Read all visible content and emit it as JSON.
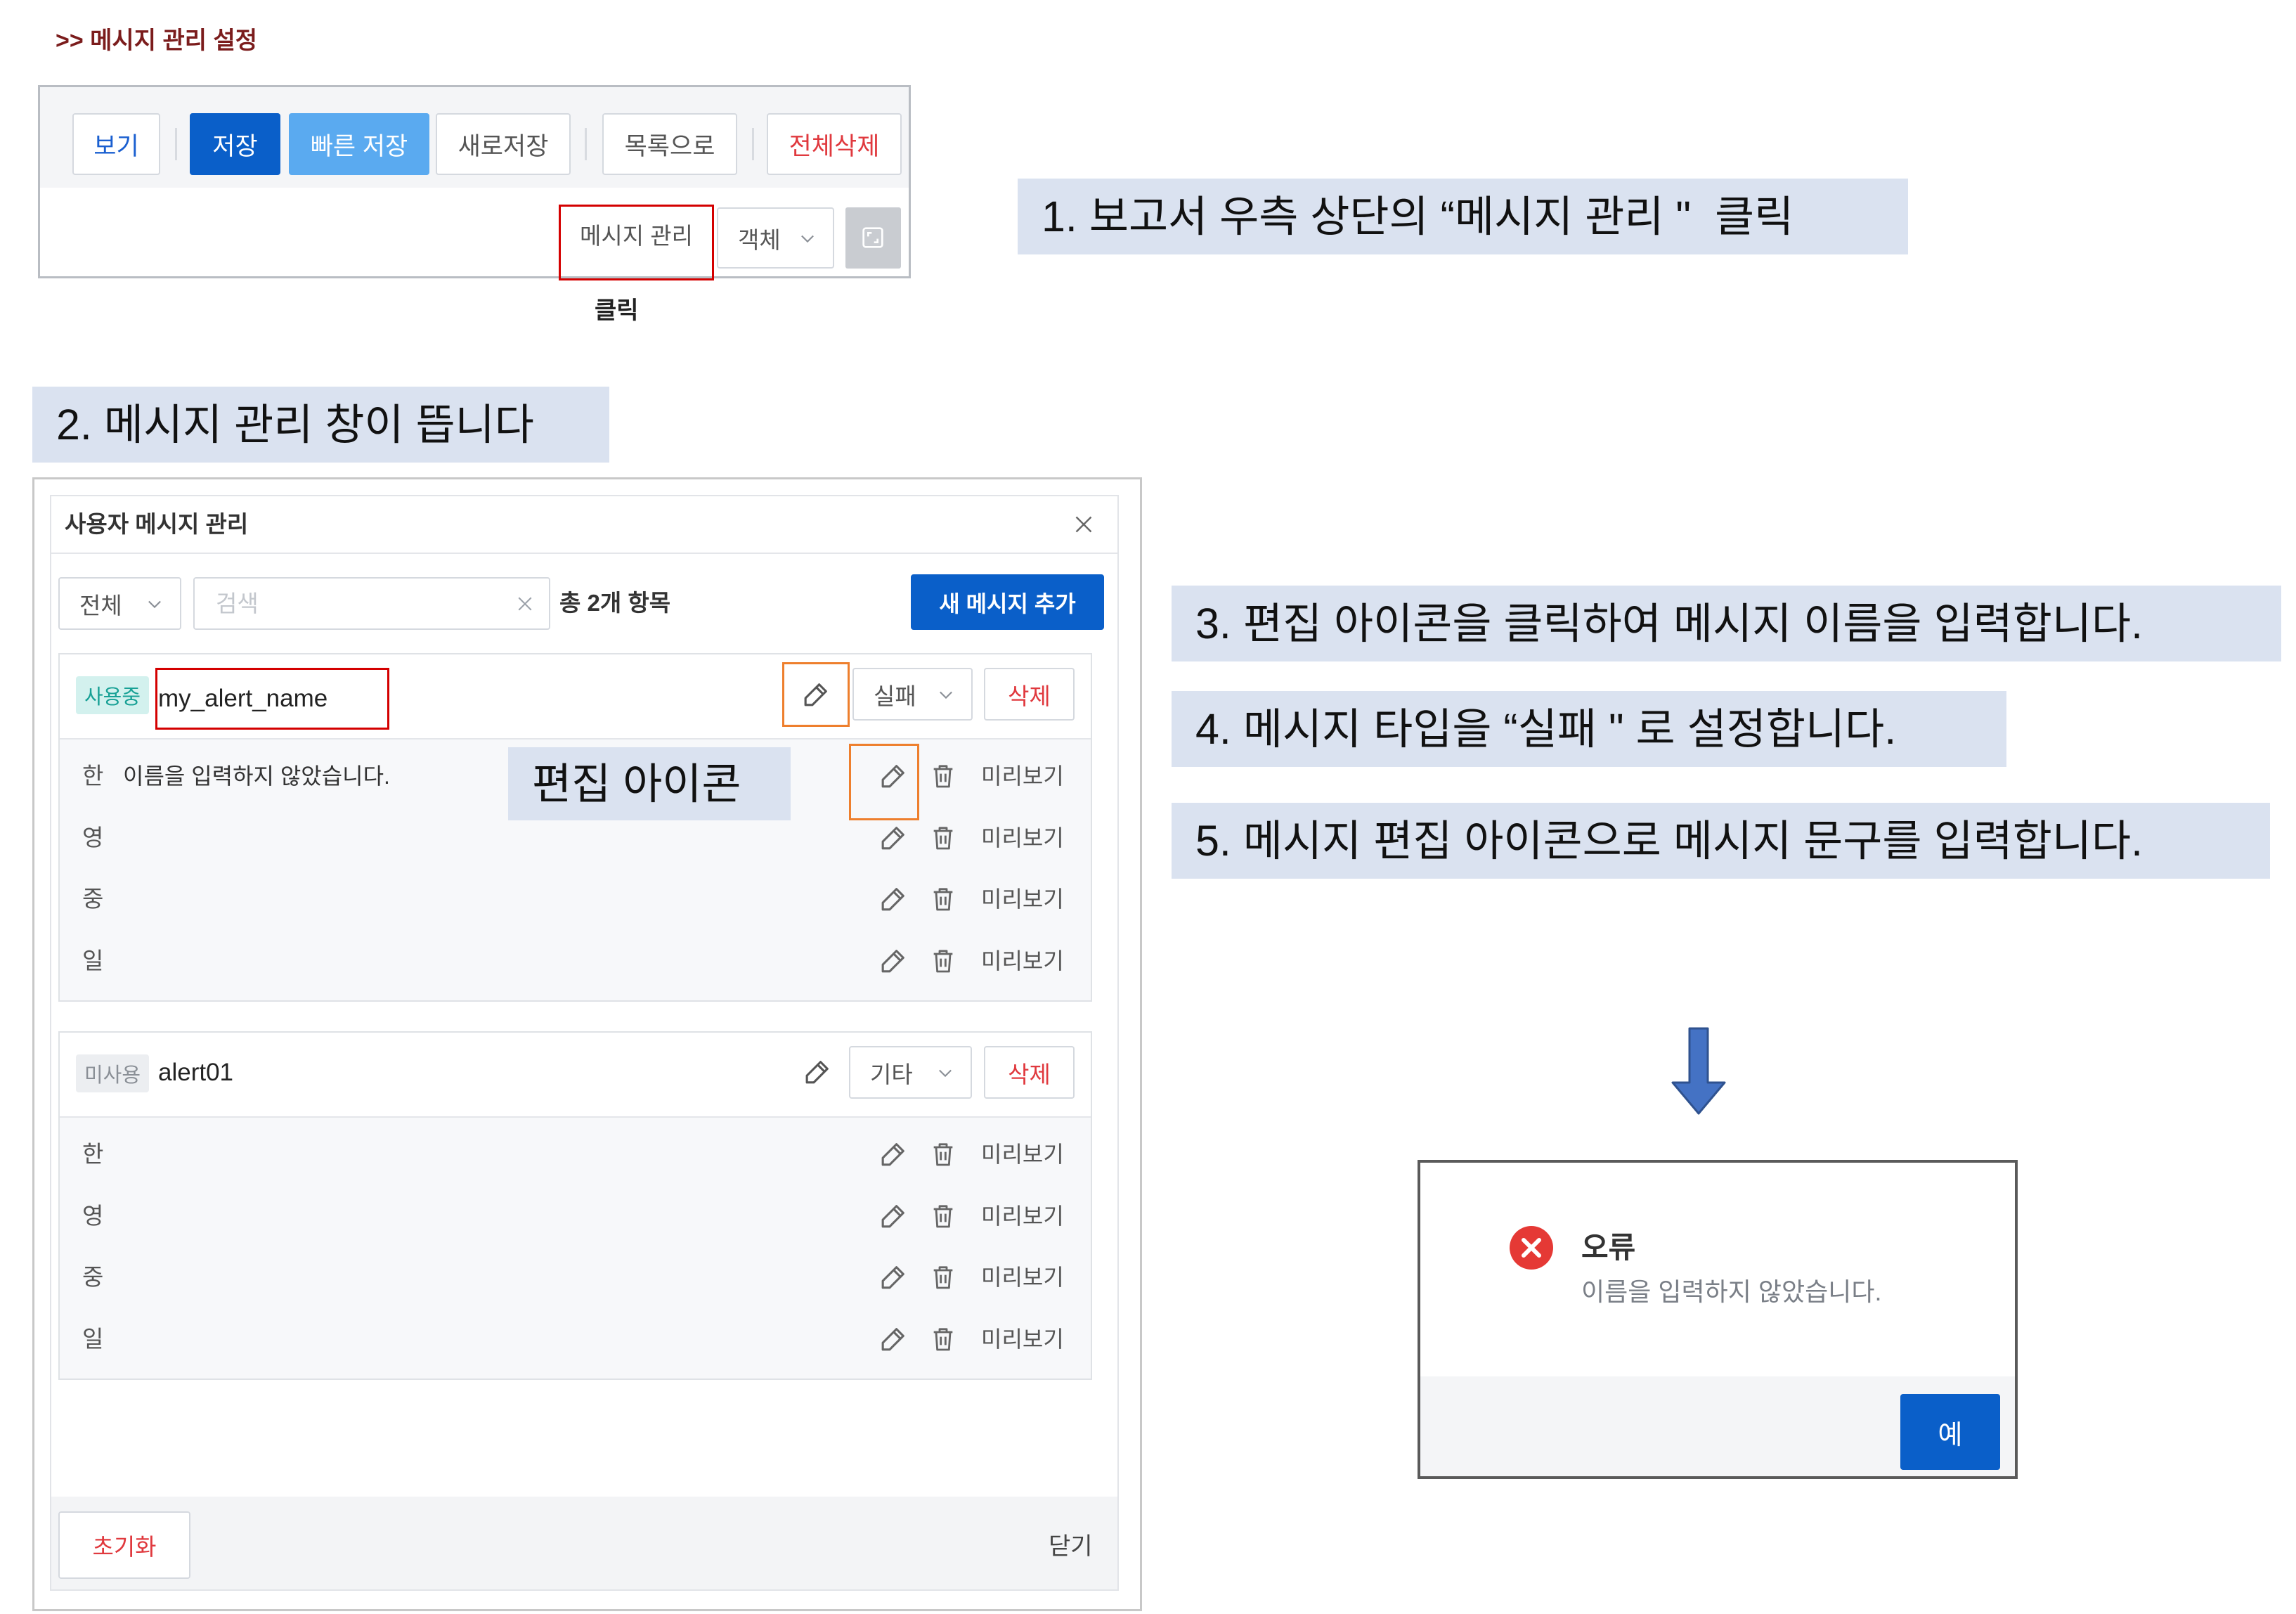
{
  "heading": ">> 메시지 관리 설정",
  "toolbar": {
    "view_label": "보기",
    "save_label": "저장",
    "quick_save_label": "빠른 저장",
    "save_as_label": "새로저장",
    "to_list_label": "목록으로",
    "delete_all_label": "전체삭제",
    "message_manage_label": "메시지 관리",
    "object_select_value": "객체",
    "click_note": "클릭"
  },
  "callouts": {
    "step1": "1. 보고서 우측 상단의 “메시지 관리 \"  클릭",
    "step2": "2. 메시지 관리 창이 뜹니다",
    "step3": "3. 편집 아이콘을 클릭하여 메시지 이름을 입력합니다.",
    "step4": "4. 메시지 타입을 “실패 \" 로 설정합니다.",
    "step5": "5. 메시지 편집 아이콘으로 메시지 문구를 입력합니다.",
    "edit_icon_note": "편집 아이콘"
  },
  "dialog": {
    "title": "사용자 메시지 관리",
    "filter_value": "전체",
    "search_placeholder": "검색",
    "total_count": "총 2개 항목",
    "add_button": "새 메시지 추가",
    "preview_label": "미리보기",
    "delete_label": "삭제",
    "messages": [
      {
        "status": "사용중",
        "name": "my_alert_name",
        "type": "실패",
        "rows": [
          {
            "lang": "한",
            "text": "이름을 입력하지 않았습니다."
          },
          {
            "lang": "영"
          },
          {
            "lang": "중"
          },
          {
            "lang": "일"
          }
        ]
      },
      {
        "status": "미사용",
        "name": "alert01",
        "type": "기타",
        "rows": [
          {
            "lang": "한"
          },
          {
            "lang": "영"
          },
          {
            "lang": "중"
          },
          {
            "lang": "일"
          }
        ]
      }
    ],
    "reset_button": "초기화",
    "close_label": "닫기"
  },
  "error_dialog": {
    "title": "오류",
    "message": "이름을 입력하지 않았습니다.",
    "ok_button": "예"
  },
  "icons": {
    "edit": "pencil-icon",
    "delete_row": "trash-icon",
    "dropdown": "chevron-down-icon",
    "close": "close-icon",
    "clear_search": "clear-icon",
    "expand": "expand-icon",
    "error": "error-icon",
    "flow_arrow": "arrow-down-icon"
  },
  "colors": {
    "primary": "#0a5fc9",
    "primary_light": "#5aaaf0",
    "danger": "#e0393e",
    "callout_bg": "#dae2f0",
    "highlight_red": "#d40000",
    "highlight_orange": "#ee7f2d",
    "badge_active_bg": "#d3f1ee",
    "badge_active_text": "#17a095",
    "badge_inactive_bg": "#eceef1",
    "badge_inactive_text": "#8a8f96",
    "arrow": "#4472c4",
    "heading": "#7b1c1c"
  }
}
